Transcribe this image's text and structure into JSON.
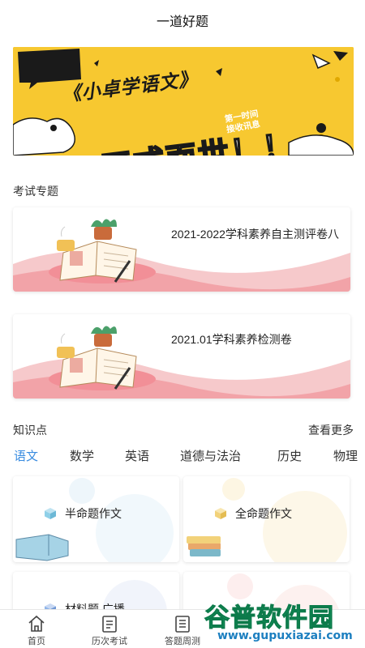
{
  "header": {
    "title": "一道好题"
  },
  "banner": {
    "title": "《小卓学语文》",
    "subtitle_line1": "第一时间",
    "subtitle_line2": "接收讯息",
    "main": "正式面世！！"
  },
  "exam_section": {
    "title": "考试专题",
    "cards": [
      {
        "title": "2021-2022学科素养自主测评卷八"
      },
      {
        "title": "2021.01学科素养检测卷"
      }
    ]
  },
  "knowledge": {
    "title": "知识点",
    "more": "查看更多",
    "subjects": [
      "语文",
      "数学",
      "英语",
      "道德与法治",
      "历史",
      "物理"
    ],
    "active_subject": "语文",
    "topics": [
      {
        "label": "半命题作文",
        "cube_color": "#8fd0e8"
      },
      {
        "label": "全命题作文",
        "cube_color": "#f2d27a"
      },
      {
        "label": "材料题 广播",
        "cube_color": "#8fb4e8"
      },
      {
        "label": "",
        "cube_color": "#f2b0a0"
      }
    ]
  },
  "tabbar": {
    "items": [
      {
        "label": "首页",
        "icon": "home-icon"
      },
      {
        "label": "历次考试",
        "icon": "history-exam-icon"
      },
      {
        "label": "答题周测",
        "icon": "weekly-test-icon"
      }
    ]
  },
  "watermark": {
    "main": "谷普软件园",
    "url": "www.gupuxiazai.com"
  },
  "colors": {
    "accent": "#3a8ce0",
    "banner_yellow": "#f7c830",
    "watermark_green": "#1ba66a"
  }
}
